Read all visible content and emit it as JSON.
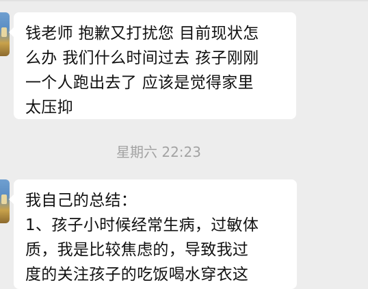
{
  "messages": [
    {
      "lines": [
        "钱老师 抱歉又打扰您 目前现状怎",
        "么办 我们什么时间过去 孩子刚刚",
        "一个人跑出去了 应该是觉得家里",
        "太压抑"
      ]
    },
    {
      "lines": [
        "我自己的总结：",
        "1、孩子小时候经常生病，过敏体",
        "质，我是比较焦虑的，导致我过",
        "度的关注孩子的吃饭喝水穿衣这"
      ]
    }
  ],
  "timestamp": "星期六 22:23",
  "colors": {
    "background": "#ededed",
    "bubble": "#ffffff",
    "text": "#111111",
    "timestamp": "#a3a3a3"
  }
}
